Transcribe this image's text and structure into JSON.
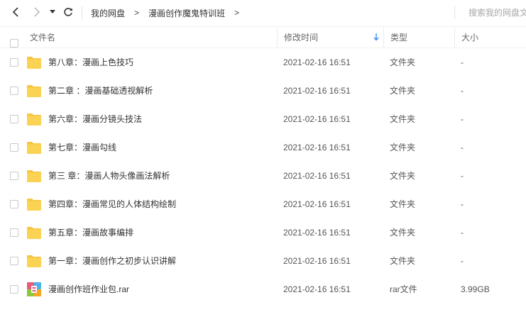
{
  "nav": {
    "back_icon": "chevron-left-icon",
    "forward_icon": "chevron-right-icon",
    "history_icon": "caret-down-icon",
    "refresh_icon": "refresh-icon"
  },
  "breadcrumb": {
    "items": [
      "我的网盘",
      "漫画创作魔鬼特训班"
    ],
    "separator": ">"
  },
  "search": {
    "placeholder": "搜索我的网盘文件"
  },
  "columns": {
    "name": "文件名",
    "time": "修改时间",
    "type": "类型",
    "size": "大小"
  },
  "sort": {
    "column": "time",
    "icon": "arrow-down-icon",
    "color": "#3b8cf5"
  },
  "files": [
    {
      "name": "第八章：漫画上色技巧",
      "time": "2021-02-16 16:51",
      "type": "文件夹",
      "size": "-",
      "icon": "folder-icon"
    },
    {
      "name": "第二章 ：漫画基础透视解析",
      "time": "2021-02-16 16:51",
      "type": "文件夹",
      "size": "-",
      "icon": "folder-icon"
    },
    {
      "name": "第六章：漫画分镜头技法",
      "time": "2021-02-16 16:51",
      "type": "文件夹",
      "size": "-",
      "icon": "folder-icon"
    },
    {
      "name": "第七章：漫画勾线",
      "time": "2021-02-16 16:51",
      "type": "文件夹",
      "size": "-",
      "icon": "folder-icon"
    },
    {
      "name": "第三 章：漫画人物头像画法解析",
      "time": "2021-02-16 16:51",
      "type": "文件夹",
      "size": "-",
      "icon": "folder-icon"
    },
    {
      "name": "第四章：漫画常见的人体结构绘制",
      "time": "2021-02-16 16:51",
      "type": "文件夹",
      "size": "-",
      "icon": "folder-icon"
    },
    {
      "name": "第五章：漫画故事编排",
      "time": "2021-02-16 16:51",
      "type": "文件夹",
      "size": "-",
      "icon": "folder-icon"
    },
    {
      "name": "第一章：漫画创作之初步认识讲解",
      "time": "2021-02-16 16:51",
      "type": "文件夹",
      "size": "-",
      "icon": "folder-icon"
    },
    {
      "name": "漫画创作班作业包.rar",
      "time": "2021-02-16 16:51",
      "type": "rar文件",
      "size": "3.99GB",
      "icon": "rar-archive-icon"
    }
  ],
  "colors": {
    "folder": "#fbd354",
    "folder_tab": "#f7c540",
    "accent": "#3b8cf5"
  }
}
